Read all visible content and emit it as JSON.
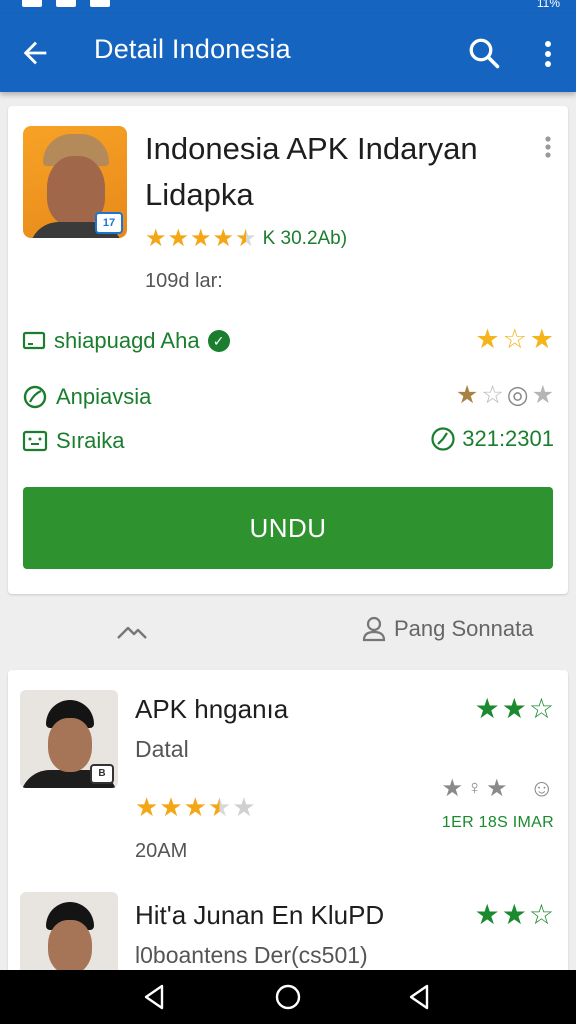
{
  "status_bar": {
    "battery": "11%"
  },
  "app_bar": {
    "title": "Detail Indonesia"
  },
  "app": {
    "name": "Indonesia APK Indaryan Lidapka",
    "rating_count": "K 30.2Ab)",
    "rating": 4.5,
    "size": "109d lar:",
    "download_label": "UNDU"
  },
  "info_rows": [
    {
      "label": "shiapuagd Aha",
      "verified": true,
      "stars": [
        {
          "type": "full",
          "color": "#f4b41a"
        },
        {
          "type": "outline",
          "color": "#f4b41a"
        },
        {
          "type": "full",
          "color": "#f4b41a"
        }
      ]
    },
    {
      "label": "Anpiavsia",
      "stars": [
        {
          "type": "full",
          "color": "#a78342"
        },
        {
          "type": "outline",
          "color": "#b5b5b5"
        },
        {
          "type": "circle",
          "color": "#8a8a8a"
        },
        {
          "type": "full",
          "color": "#b5b5b5"
        }
      ]
    },
    {
      "label": "Sıraika",
      "time": "321:2301"
    }
  ],
  "tabs": {
    "right_label": "Pang Sonnata"
  },
  "list": [
    {
      "title": "APK hnganıa",
      "subtitle": "Datal",
      "rating": 3.5,
      "time": "20AM",
      "label": "1ER 18S IMAR"
    },
    {
      "title": "Hit'a Junan En KluPD",
      "subtitle": "l0boantens Der(cs501)"
    }
  ]
}
